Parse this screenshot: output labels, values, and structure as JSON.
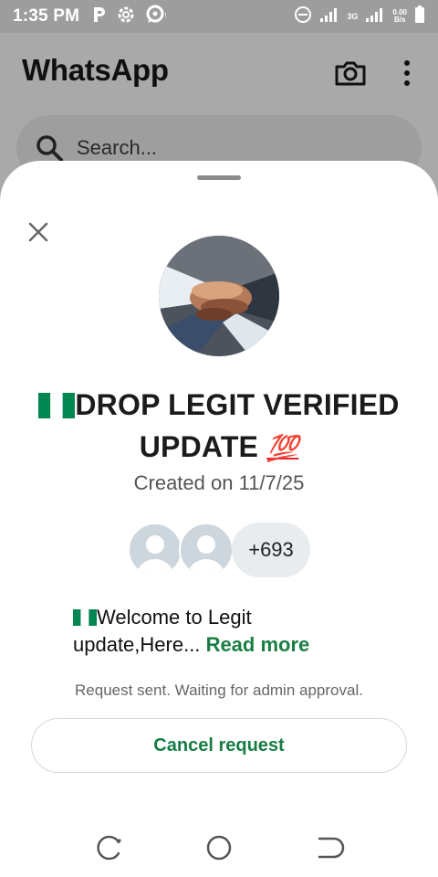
{
  "status_bar": {
    "time": "1:35 PM",
    "network_label": "3G",
    "speed_value": "0.00",
    "speed_unit": "B/s",
    "icons": [
      "p-icon",
      "gear-icon",
      "chat-bubble-icon",
      "do-not-disturb-icon",
      "signal-icon",
      "signal-icon",
      "battery-icon"
    ]
  },
  "header": {
    "title": "WhatsApp",
    "icons": [
      "camera-icon",
      "more-vert-icon"
    ]
  },
  "search": {
    "placeholder": "Search..."
  },
  "group": {
    "name_line1": "DROP LEGIT VERIFIED",
    "name_line2": "UPDATE",
    "name_emoji_flag": "nigeria-flag",
    "name_emoji_end": "💯",
    "created": "Created on 11/7/25",
    "member_count": "+693",
    "description": "Welcome to Legit update,Here...",
    "read_more": "Read more",
    "request_status": "Request sent. Waiting for admin approval.",
    "cancel_label": "Cancel request"
  },
  "colors": {
    "accent_green": "#167d43",
    "overlay_gray": "#a9a9a9",
    "flag_green": "#008751"
  },
  "nav_bar": {
    "icons": [
      "recent-apps-icon",
      "home-icon",
      "back-icon"
    ]
  }
}
